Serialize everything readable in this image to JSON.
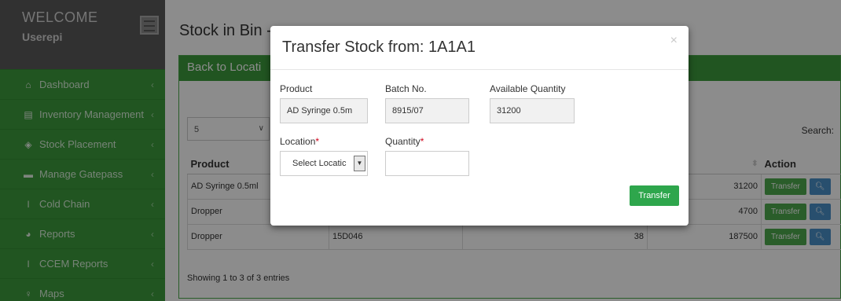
{
  "sidebar": {
    "welcome": "WELCOME",
    "user": "Userepi",
    "items": [
      {
        "label": "Dashboard",
        "icon": "home-icon"
      },
      {
        "label": "Inventory Management",
        "icon": "printer-icon"
      },
      {
        "label": "Stock Placement",
        "icon": "box-icon"
      },
      {
        "label": "Manage Gatepass",
        "icon": "id-card-icon"
      },
      {
        "label": "Cold Chain",
        "icon": "thermometer-icon"
      },
      {
        "label": "Reports",
        "icon": "pie-chart-icon"
      },
      {
        "label": "CCEM Reports",
        "icon": "thermometer-icon"
      },
      {
        "label": "Maps",
        "icon": "map-marker-icon"
      }
    ]
  },
  "main": {
    "page_title": "Stock in Bin -",
    "panel_heading": "Back to Locati",
    "length_value": "5",
    "search_label": "Search:",
    "columns": {
      "product": "Product",
      "action": "Action"
    },
    "rows": [
      {
        "product": "AD Syringe 0.5ml",
        "batch": "",
        "qty": "",
        "available": "31200"
      },
      {
        "product": "Dropper",
        "batch": "",
        "qty": "",
        "available": "4700"
      },
      {
        "product": "Dropper",
        "batch": "15D046",
        "qty": "38",
        "available": "187500"
      }
    ],
    "transfer_label": "Transfer",
    "showing": "Showing 1 to 3 of 3 entries"
  },
  "modal": {
    "title": "Transfer Stock from: 1A1A1",
    "close": "×",
    "product_label": "Product",
    "product_value": "AD Syringe 0.5m",
    "batch_label": "Batch No.",
    "batch_value": "8915/07",
    "avail_label": "Available Quantity",
    "avail_value": "31200",
    "location_label": "Location",
    "location_value": "Select Locatic",
    "quantity_label": "Quantity",
    "quantity_value": "",
    "required_mark": "*",
    "transfer_button": "Transfer"
  }
}
